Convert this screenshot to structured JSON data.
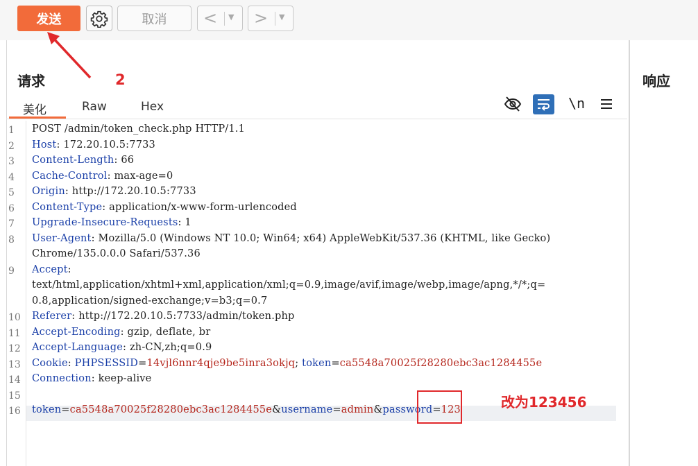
{
  "toolbar": {
    "send_label": "发送",
    "cancel_label": "取消"
  },
  "request": {
    "title": "请求",
    "tabs": [
      "美化",
      "Raw",
      "Hex"
    ],
    "active_tab": "美化",
    "lines": [
      {
        "n": "1",
        "parts": [
          [
            "t",
            "POST /admin/token_check.php HTTP/1.1"
          ]
        ]
      },
      {
        "n": "2",
        "parts": [
          [
            "k",
            "Host"
          ],
          [
            "t",
            ": 172.20.10.5:7733"
          ]
        ]
      },
      {
        "n": "3",
        "parts": [
          [
            "k",
            "Content-Length"
          ],
          [
            "t",
            ": 66"
          ]
        ]
      },
      {
        "n": "4",
        "parts": [
          [
            "k",
            "Cache-Control"
          ],
          [
            "t",
            ": max-age=0"
          ]
        ]
      },
      {
        "n": "5",
        "parts": [
          [
            "k",
            "Origin"
          ],
          [
            "t",
            ": http://172.20.10.5:7733"
          ]
        ]
      },
      {
        "n": "6",
        "parts": [
          [
            "k",
            "Content-Type"
          ],
          [
            "t",
            ": application/x-www-form-urlencoded"
          ]
        ]
      },
      {
        "n": "7",
        "parts": [
          [
            "k",
            "Upgrade-Insecure-Requests"
          ],
          [
            "t",
            ": 1"
          ]
        ]
      },
      {
        "n": "8",
        "parts": [
          [
            "k",
            "User-Agent"
          ],
          [
            "t",
            ": Mozilla/5.0 (Windows NT 10.0; Win64; x64) AppleWebKit/537.36 (KHTML, like Gecko)"
          ]
        ]
      },
      {
        "n": "",
        "parts": [
          [
            "t",
            "Chrome/135.0.0.0 Safari/537.36"
          ]
        ]
      },
      {
        "n": "9",
        "parts": [
          [
            "k",
            "Accept"
          ],
          [
            "t",
            ":"
          ]
        ]
      },
      {
        "n": "",
        "parts": [
          [
            "t",
            "text/html,application/xhtml+xml,application/xml;q=0.9,image/avif,image/webp,image/apng,*/*;q="
          ]
        ]
      },
      {
        "n": "",
        "parts": [
          [
            "t",
            "0.8,application/signed-exchange;v=b3;q=0.7"
          ]
        ]
      },
      {
        "n": "10",
        "parts": [
          [
            "k",
            "Referer"
          ],
          [
            "t",
            ": http://172.20.10.5:7733/admin/token.php"
          ]
        ]
      },
      {
        "n": "11",
        "parts": [
          [
            "k",
            "Accept-Encoding"
          ],
          [
            "t",
            ": gzip, deflate, br"
          ]
        ]
      },
      {
        "n": "12",
        "parts": [
          [
            "k",
            "Accept-Language"
          ],
          [
            "t",
            ": zh-CN,zh;q=0.9"
          ]
        ]
      },
      {
        "n": "13",
        "parts": [
          [
            "k",
            "Cookie"
          ],
          [
            "t",
            ": "
          ],
          [
            "k",
            "PHPSESSID"
          ],
          [
            "t",
            "="
          ],
          [
            "v",
            "14vjl6nnr4qje9be5inra3okjq"
          ],
          [
            "t",
            "; "
          ],
          [
            "k",
            "token"
          ],
          [
            "t",
            "="
          ],
          [
            "v",
            "ca5548a70025f28280ebc3ac1284455e"
          ]
        ]
      },
      {
        "n": "14",
        "parts": [
          [
            "k",
            "Connection"
          ],
          [
            "t",
            ": keep-alive"
          ]
        ]
      },
      {
        "n": "15",
        "parts": []
      },
      {
        "n": "16",
        "parts": [
          [
            "k",
            "token"
          ],
          [
            "t",
            "="
          ],
          [
            "v",
            "ca5548a70025f28280ebc3ac1284455e"
          ],
          [
            "t",
            "&"
          ],
          [
            "k",
            "username"
          ],
          [
            "t",
            "="
          ],
          [
            "v",
            "admin"
          ],
          [
            "t",
            "&"
          ],
          [
            "k",
            "password"
          ],
          [
            "t",
            "="
          ],
          [
            "v",
            "123"
          ]
        ]
      }
    ]
  },
  "response": {
    "title": "响应"
  },
  "annotations": {
    "step_number": "2",
    "change_note": "改为123456"
  },
  "colors": {
    "accent": "#f26b3a",
    "annotation_red": "#e0282b",
    "header_key": "#1a3fa8",
    "param_value": "#b5261c"
  },
  "icons": [
    "gear-icon",
    "back-arrow-icon",
    "forward-arrow-icon",
    "eye-off-icon",
    "wrap-icon",
    "newline-icon",
    "menu-icon"
  ]
}
